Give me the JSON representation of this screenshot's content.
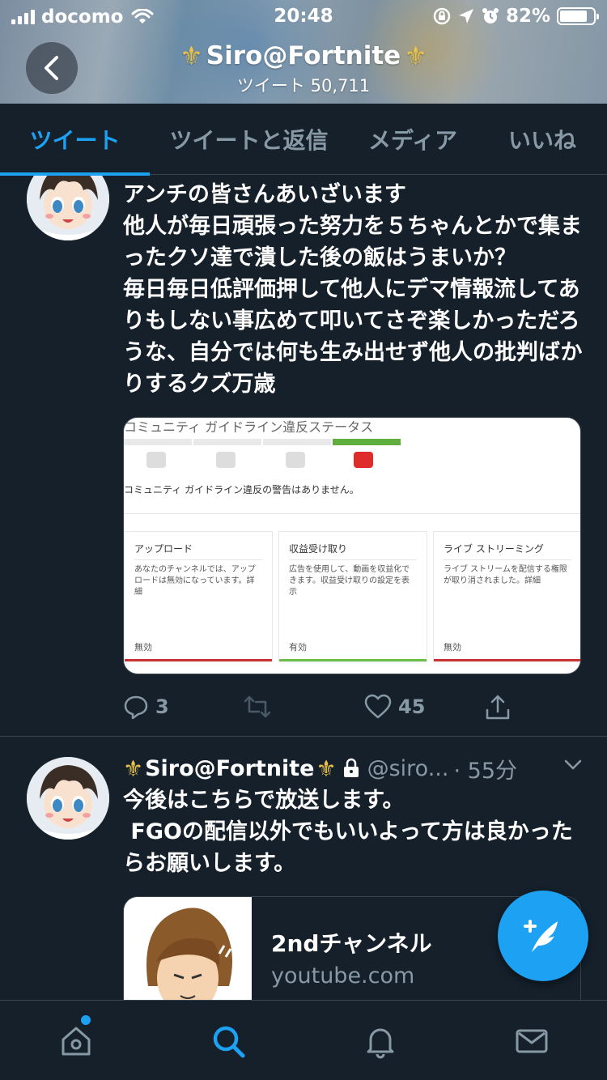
{
  "status_bar": {
    "carrier": "docomo",
    "time": "20:48",
    "battery": "82%",
    "battery_level": 0.82
  },
  "header": {
    "title": "Siro@Fortnite",
    "subtitle": "ツイート 50,711",
    "title_emoji": "⚜"
  },
  "tabs": [
    {
      "label": "ツイート",
      "active": true
    },
    {
      "label": "ツイートと返信",
      "active": false
    },
    {
      "label": "メディア",
      "active": false
    },
    {
      "label": "いいね",
      "active": false
    }
  ],
  "tweet1": {
    "text": "アンチの皆さんあいざいます\n他人が毎日頑張った努力を５ちゃんとかで集まったクソ達で潰した後の飯はうまいか？\n毎日毎日低評価押して他人にデマ情報流してありもしない事広めて叩いてさぞ楽しかっただろうな、自分では何も生み出せず他人の批判ばかりするクズ万歳",
    "media": {
      "title": "コミュニティ ガイドライン違反ステータス",
      "note": "コミュニティ ガイドライン違反の警告はありません。",
      "cards": [
        {
          "title": "アップロード",
          "desc": "あなたのチャンネルでは、アップロードは無効になっています。詳細",
          "status": "無効",
          "color": "#cc3333"
        },
        {
          "title": "収益受け取り",
          "desc": "広告を使用して、動画を収益化できます。収益受け取りの設定を表示",
          "status": "有効",
          "color": "#6cbf4a"
        },
        {
          "title": "ライブ ストリーミング",
          "desc": "ライブ ストリームを配信する権限が取り消されました。詳細",
          "status": "無効",
          "color": "#cc3333"
        }
      ]
    },
    "replies": "3",
    "likes": "45"
  },
  "tweet2": {
    "name": "Siro@Fortnite",
    "handle": "@siro...",
    "time": "· 55分",
    "text": "今後はこちらで放送します。\n FGOの配信以外でもいいよって方は良かったらお願いします。",
    "card_title": "2ndチャンネル",
    "card_domain": "youtube.com"
  },
  "colors": {
    "background": "#15202b",
    "accent": "#1da1f2",
    "muted": "#8899a6",
    "border": "#38444d",
    "fleur": "#e8c24a"
  },
  "nav": [
    "home-icon",
    "search-icon",
    "notifications-icon",
    "messages-icon"
  ]
}
